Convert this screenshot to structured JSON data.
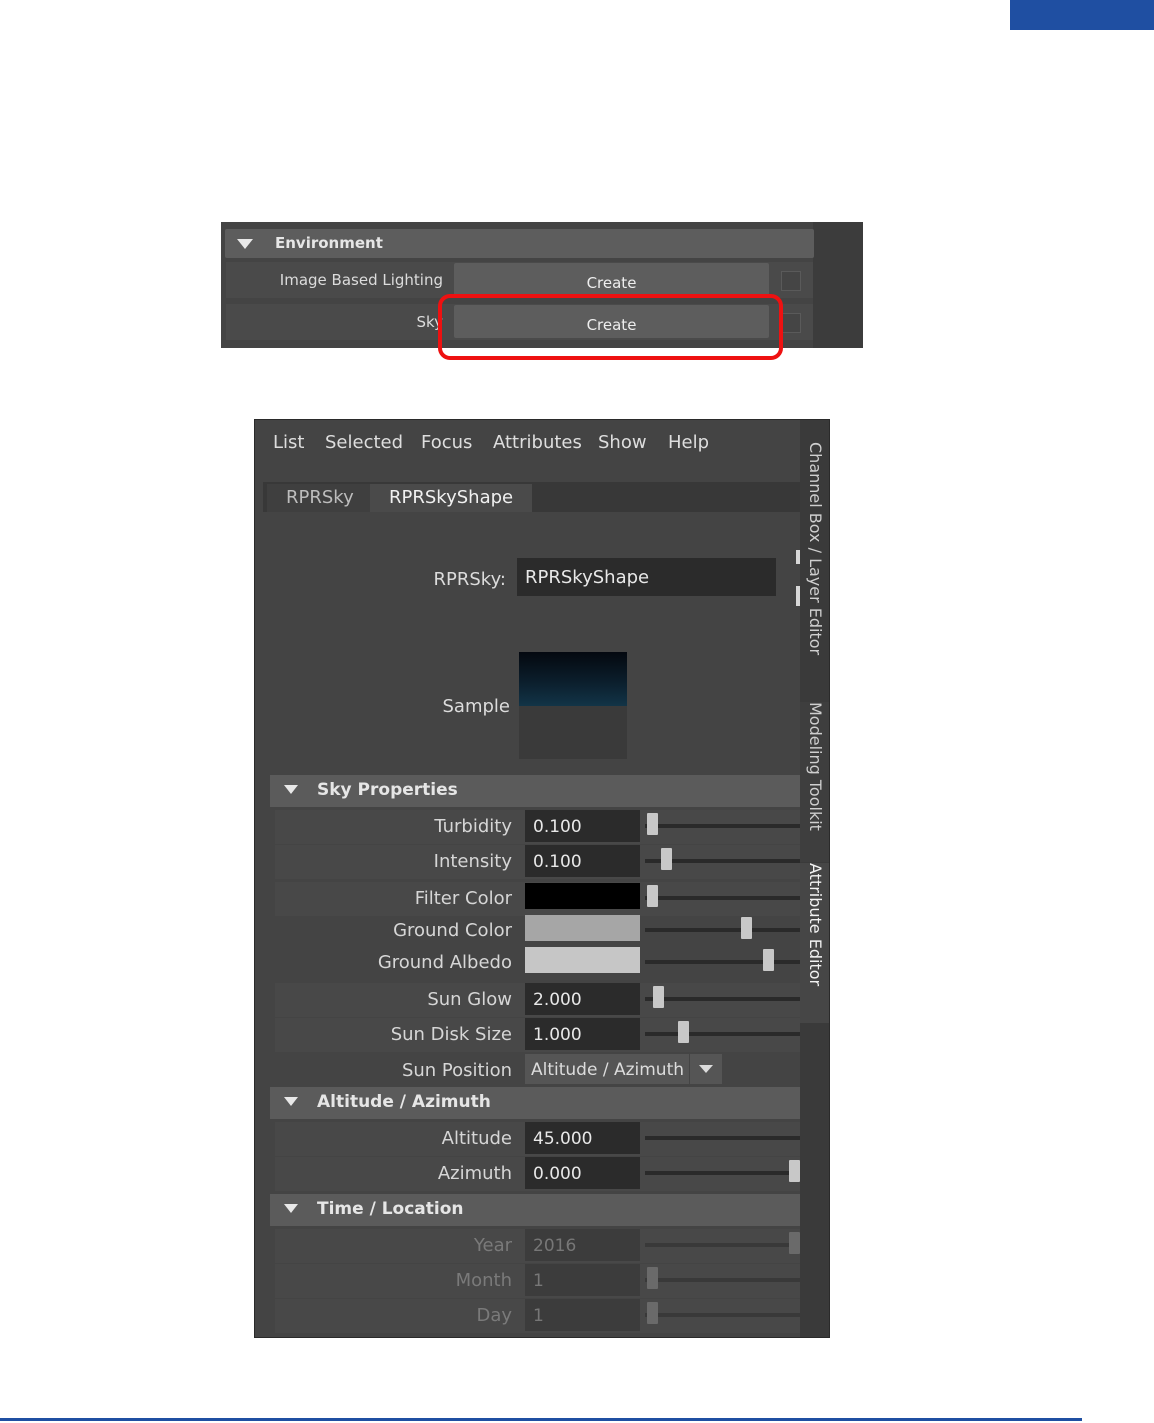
{
  "environment": {
    "title": "Environment",
    "rows": [
      {
        "label": "Image Based Lighting",
        "button": "Create"
      },
      {
        "label": "Sky",
        "button": "Create"
      }
    ]
  },
  "attribute_editor": {
    "menu": [
      "List",
      "Selected",
      "Focus",
      "Attributes",
      "Show",
      "Help"
    ],
    "tabs": [
      "RPRSky",
      "RPRSkyShape"
    ],
    "node_label": "RPRSky:",
    "node_value": "RPRSkyShape",
    "sample_label": "Sample",
    "side_tabs": [
      "Channel Box / Layer Editor",
      "Modeling Toolkit",
      "Attribute Editor"
    ],
    "sections": {
      "sky": {
        "title": "Sky Properties",
        "turbidity": {
          "label": "Turbidity",
          "value": "0.100",
          "slider": 0.0
        },
        "intensity": {
          "label": "Intensity",
          "value": "0.100",
          "slider": 0.1
        },
        "filter_color": {
          "label": "Filter Color",
          "color": "#000000",
          "slider": 0.0
        },
        "ground_color": {
          "label": "Ground Color",
          "color": "#a6a6a6",
          "slider": 0.66
        },
        "ground_albedo": {
          "label": "Ground Albedo",
          "color": "#c6c6c6",
          "slider": 0.82
        },
        "sun_glow": {
          "label": "Sun Glow",
          "value": "2.000",
          "slider": 0.04
        },
        "sun_disk_size": {
          "label": "Sun Disk Size",
          "value": "1.000",
          "slider": 0.22
        },
        "sun_position": {
          "label": "Sun Position",
          "value": "Altitude / Azimuth"
        }
      },
      "altaz": {
        "title": "Altitude / Azimuth",
        "altitude": {
          "label": "Altitude",
          "value": "45.000"
        },
        "azimuth": {
          "label": "Azimuth",
          "value": "0.000",
          "slider": 1.0
        }
      },
      "time": {
        "title": "Time / Location",
        "year": {
          "label": "Year",
          "value": "2016",
          "slider": 1.0
        },
        "month": {
          "label": "Month",
          "value": "1",
          "slider": 0.0
        },
        "day": {
          "label": "Day",
          "value": "1",
          "slider": 0.0
        }
      }
    }
  }
}
